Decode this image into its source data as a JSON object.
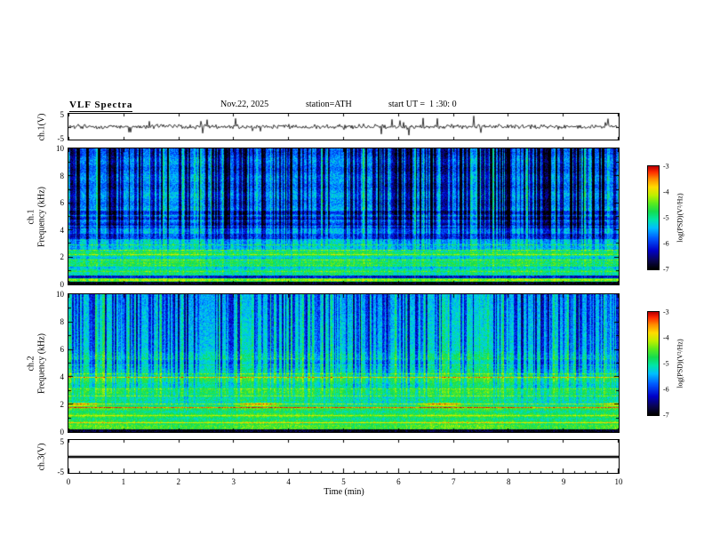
{
  "header": {
    "title": "VLF Spectra",
    "date": "Nov.22, 2025",
    "station": "station=ATH",
    "start_ut": "start UT =  1 :30: 0"
  },
  "x_axis": {
    "label": "Time (min)",
    "tick_labels": [
      "0",
      "1",
      "2",
      "3",
      "4",
      "5",
      "6",
      "7",
      "8",
      "9",
      "10"
    ]
  },
  "panels": {
    "wave1": {
      "ylabel": "ch.1(V)",
      "ytick_top": "5",
      "ytick_bottom": "-5"
    },
    "spec1": {
      "channel_label": "ch.1",
      "ylabel": "Frequency (kHz)",
      "ytick_labels": [
        "10",
        "8",
        "6",
        "4",
        "2",
        "0"
      ]
    },
    "spec2": {
      "channel_label": "ch.2",
      "ylabel": "Frequency (kHz)",
      "ytick_labels": [
        "10",
        "8",
        "6",
        "4",
        "2",
        "0"
      ]
    },
    "wave3": {
      "ylabel": "ch.3(V)",
      "ytick_top": "5",
      "ytick_bottom": "-5"
    }
  },
  "colorbar": {
    "label": "log(PSD)(V²/Hz)",
    "tick_labels": [
      "-3",
      "-4",
      "-5",
      "-6",
      "-7"
    ]
  },
  "colors": {
    "scale_top": "#c00000",
    "scale_bottom": "#000000",
    "trace": "#000000"
  },
  "chart_data": [
    {
      "type": "line",
      "name": "ch.1 voltage waveform",
      "xlabel": "Time (min)",
      "xlim": [
        0,
        10
      ],
      "ylabel": "ch.1(V)",
      "ylim": [
        -5,
        5
      ],
      "summary": "continuous broadband noise centred on 0 V, typical excursions ±1-2 V with frequent impulsive spikes reaching about ±4 V"
    },
    {
      "type": "heatmap",
      "name": "ch.1 VLF spectrogram",
      "xlabel": "Time (min)",
      "xlim": [
        0,
        10
      ],
      "ylabel": "Frequency (kHz)",
      "ylim": [
        0,
        10
      ],
      "colorbar_label": "log(PSD)(V²/Hz)",
      "clim": [
        -7,
        -3
      ],
      "summary": "green/yellow power (~-4 to -5) below ~3 kHz with narrow enhanced horizontal lines; darker blue band 4-5.5 kHz; blue background above 5 kHz crossed by dense dark vertical sferic streaks down to -7 (black); black band below ~0.2 kHz"
    },
    {
      "type": "heatmap",
      "name": "ch.2 VLF spectrogram",
      "xlabel": "Time (min)",
      "xlim": [
        0,
        10
      ],
      "ylabel": "Frequency (kHz)",
      "ylim": [
        0,
        10
      ],
      "colorbar_label": "log(PSD)(V²/Hz)",
      "clim": [
        -7,
        -3
      ],
      "summary": "mostly green (~-4.5 to -5) with bright yellow/red horizontal lines near 1.8-2.1 kHz and 3.9-4.2 kHz, intermittent red patches near 2 kHz, vertical dark sferic streaks above ~4 kHz; black band below ~0.2 kHz"
    },
    {
      "type": "line",
      "name": "ch.3 voltage waveform",
      "xlabel": "Time (min)",
      "xlim": [
        0,
        10
      ],
      "ylabel": "ch.3(V)",
      "ylim": [
        -5,
        5
      ],
      "summary": "flat line at 0 V for the entire record"
    }
  ]
}
